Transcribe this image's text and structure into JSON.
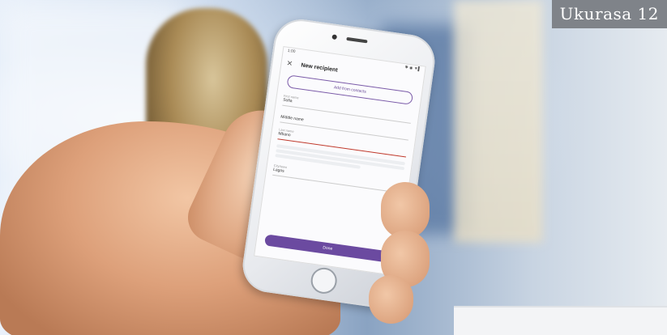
{
  "caption": "Ukurasa 12",
  "phone_app": {
    "status_time": "1:00",
    "status_icons": "✱ ◉ ▼▌",
    "title": "New recipient",
    "add_button": "Add from contacts",
    "fields": [
      {
        "label": "First name",
        "value": "Sofia"
      },
      {
        "label": "",
        "value": "Middle name"
      },
      {
        "label": "Last name",
        "value": "Mbano"
      }
    ],
    "city_label": "City/town",
    "city_value": "Lagos",
    "done_button": "Done"
  },
  "colors": {
    "accent": "#6b4aa0",
    "caption_bg": "#7f8389"
  }
}
